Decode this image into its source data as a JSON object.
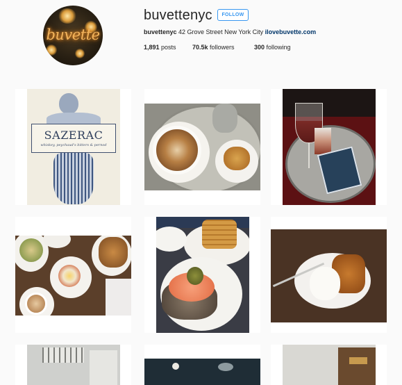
{
  "profile": {
    "username": "buvettenyc",
    "follow_label": "FOLLOW",
    "avatar_text": "buvette",
    "bio_name": "buvettenyc",
    "bio_text": "42 Grove Street New York City",
    "bio_link": "ilovebuvette.com",
    "posts_count": "1,891",
    "posts_label": "posts",
    "followers_count": "70.5k",
    "followers_label": "followers",
    "following_count": "300",
    "following_label": "following"
  },
  "posts": [
    {
      "subject": "sazerac-menu-card",
      "title": "SAZERAC",
      "caption": "whiskey, peychaud's bitters & pernod"
    },
    {
      "subject": "latte-and-pastry"
    },
    {
      "subject": "wine-glasses-on-tray"
    },
    {
      "subject": "brunch-table-overhead"
    },
    {
      "subject": "waffle-and-smoked-salmon-toast"
    },
    {
      "subject": "tarte-tatin-with-cream"
    },
    {
      "subject": "chandelier-interior"
    },
    {
      "subject": "dark-table-with-eggs"
    },
    {
      "subject": "bar-shelves"
    }
  ]
}
